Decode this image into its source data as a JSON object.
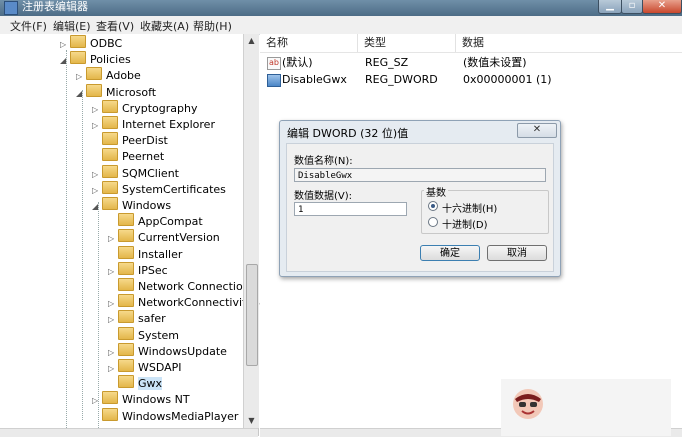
{
  "window": {
    "title": "注册表编辑器",
    "controls": [
      "▁",
      "▫",
      "✕"
    ]
  },
  "menu": [
    "文件(F)",
    "编辑(E)",
    "查看(V)",
    "收藏夹(A)",
    "帮助(H)"
  ],
  "tree": [
    {
      "label": "ODBC",
      "expander": "▷",
      "selected": false
    },
    {
      "label": "Policies",
      "expander": "◢",
      "selected": false
    },
    {
      "label": "Adobe",
      "expander": "▷",
      "selected": false
    },
    {
      "label": "Microsoft",
      "expander": "◢",
      "selected": false
    },
    {
      "label": "Cryptography",
      "expander": "▷",
      "selected": false
    },
    {
      "label": "Internet Explorer",
      "expander": "▷",
      "selected": false
    },
    {
      "label": "PeerDist",
      "expander": "",
      "selected": false
    },
    {
      "label": "Peernet",
      "expander": "",
      "selected": false
    },
    {
      "label": "SQMClient",
      "expander": "▷",
      "selected": false
    },
    {
      "label": "SystemCertificates",
      "expander": "▷",
      "selected": false
    },
    {
      "label": "Windows",
      "expander": "◢",
      "selected": false
    },
    {
      "label": "AppCompat",
      "expander": "",
      "selected": false
    },
    {
      "label": "CurrentVersion",
      "expander": "▷",
      "selected": false
    },
    {
      "label": "Installer",
      "expander": "",
      "selected": false
    },
    {
      "label": "IPSec",
      "expander": "▷",
      "selected": false
    },
    {
      "label": "Network Connections",
      "expander": "",
      "selected": false
    },
    {
      "label": "NetworkConnectivitySta",
      "expander": "▷",
      "selected": false
    },
    {
      "label": "safer",
      "expander": "▷",
      "selected": false
    },
    {
      "label": "System",
      "expander": "",
      "selected": false
    },
    {
      "label": "WindowsUpdate",
      "expander": "▷",
      "selected": false
    },
    {
      "label": "WSDAPI",
      "expander": "▷",
      "selected": false
    },
    {
      "label": "Gwx",
      "expander": "",
      "selected": true
    },
    {
      "label": "Windows NT",
      "expander": "▷",
      "selected": false
    },
    {
      "label": "WindowsMediaPlayer",
      "expander": "",
      "selected": false
    }
  ],
  "list": {
    "headers": [
      "名称",
      "类型",
      "数据"
    ],
    "rows": [
      {
        "icon": "string-value-icon",
        "icon_text": "ab",
        "name": "(默认)",
        "type": "REG_SZ",
        "data": "(数值未设置)"
      },
      {
        "icon": "binary-value-icon",
        "icon_text": "",
        "name": "DisableGwx",
        "type": "REG_DWORD",
        "data": "0x00000001 (1)"
      }
    ]
  },
  "dialog": {
    "title": "编辑 DWORD (32 位)值",
    "close_icon": "✕",
    "name_label": "数值名称(N):",
    "name_value": "DisableGwx",
    "data_label": "数值数据(V):",
    "data_value": "1",
    "base_label": "基数",
    "hex_label": "十六进制(H)",
    "dec_label": "十进制(D)",
    "hex_selected": true,
    "ok_label": "确定",
    "cancel_label": "取消"
  }
}
